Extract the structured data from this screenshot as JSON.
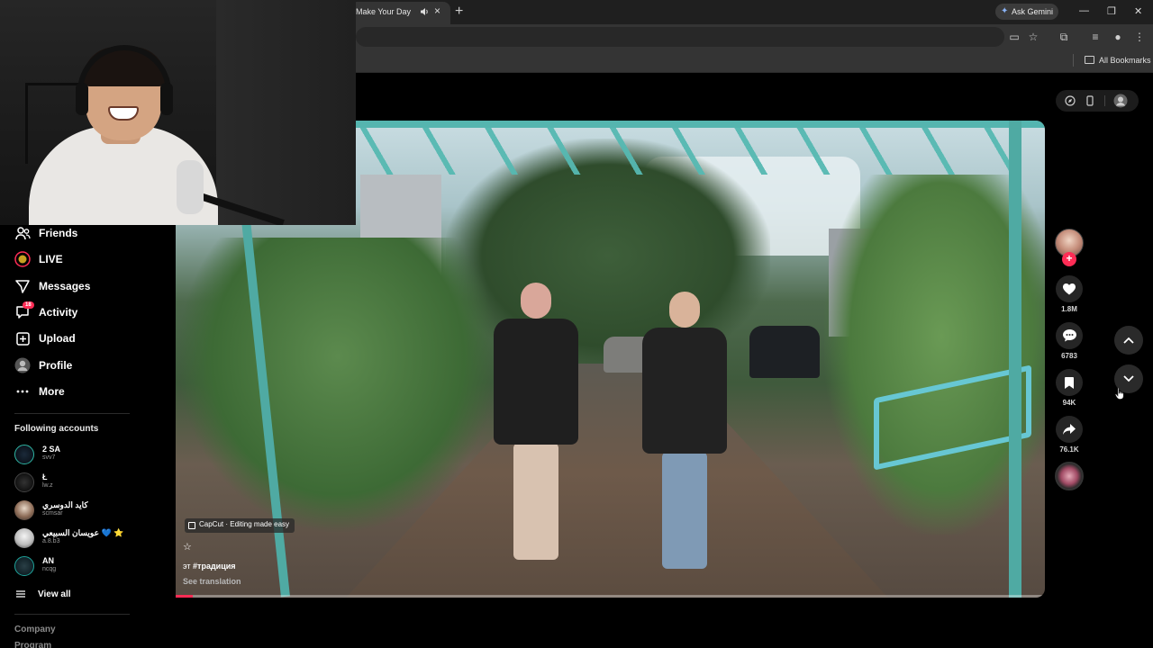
{
  "browser": {
    "tab_title": "Make Your Day",
    "gemini_label": "Ask Gemini",
    "bookmarks_label": "All Bookmarks"
  },
  "sidebar": {
    "items": [
      {
        "label": "Friends",
        "icon": "friends-icon"
      },
      {
        "label": "LIVE",
        "icon": "live-icon"
      },
      {
        "label": "Messages",
        "icon": "messages-icon"
      },
      {
        "label": "Activity",
        "icon": "activity-icon",
        "badge": "18"
      },
      {
        "label": "Upload",
        "icon": "upload-icon"
      },
      {
        "label": "Profile",
        "icon": "profile-avatar"
      },
      {
        "label": "More",
        "icon": "more-icon"
      }
    ],
    "following_title": "Following accounts",
    "accounts": [
      {
        "name": "2 SA",
        "handle": "svv7"
      },
      {
        "name": "Ł",
        "handle": "lw.z"
      },
      {
        "name": "كايد الدوسري",
        "handle": "scmsar"
      },
      {
        "name": "عويسان السبيعي 💙 ⭐",
        "handle": "a.8.b3"
      },
      {
        "name": "AN",
        "handle": "ncqg"
      }
    ],
    "view_all": "View all",
    "footer": [
      "Company",
      "Program"
    ]
  },
  "video": {
    "capcut_label": "CapCut · Editing made easy",
    "caption_prefix": "эт",
    "caption_hashtag": "#традиция",
    "see_translation": "See translation",
    "progress": 0.02
  },
  "actions": {
    "likes": "1.8M",
    "comments": "6783",
    "saves": "94K",
    "shares": "76.1K"
  },
  "colors": {
    "accent": "#fe2c55",
    "chrome_bg": "#1f1f1f",
    "toolbar_bg": "#343434"
  }
}
